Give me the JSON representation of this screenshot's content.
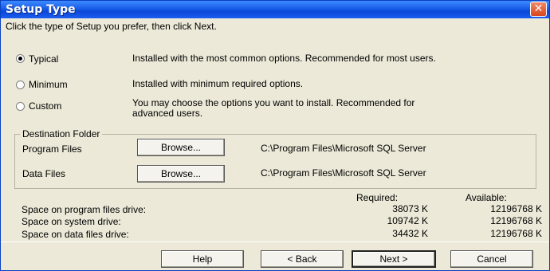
{
  "window": {
    "title": "Setup Type",
    "close_glyph": "✕"
  },
  "instruction": "Click the type of Setup you prefer, then click Next.",
  "options": [
    {
      "label": "Typical",
      "description": "Installed with the most common options. Recommended for most users.",
      "selected": true
    },
    {
      "label": "Minimum",
      "description": "Installed with minimum required options.",
      "selected": false
    },
    {
      "label": "Custom",
      "description_line1": "You may choose the options you want to install. Recommended for",
      "description_line2": "advanced users.",
      "selected": false
    }
  ],
  "destination": {
    "legend": "Destination Folder",
    "program_files": {
      "label": "Program Files",
      "browse": "Browse...",
      "path": "C:\\Program Files\\Microsoft SQL Server"
    },
    "data_files": {
      "label": "Data Files",
      "browse": "Browse...",
      "path": "C:\\Program Files\\Microsoft SQL Server"
    }
  },
  "space": {
    "required_header": "Required:",
    "available_header": "Available:",
    "rows": [
      {
        "label": "Space on program files drive:",
        "required": "38073 K",
        "available": "12196768 K"
      },
      {
        "label": "Space on system drive:",
        "required": "109742 K",
        "available": "12196768 K"
      },
      {
        "label": "Space on data files drive:",
        "required": "34432 K",
        "available": "12196768 K"
      }
    ]
  },
  "buttons": {
    "help": "Help",
    "back": "< Back",
    "next": "Next >",
    "cancel": "Cancel"
  },
  "colors": {
    "titlebar": "#0b47d8",
    "dialog_bg": "#ece9d8",
    "close": "#d8461e"
  }
}
